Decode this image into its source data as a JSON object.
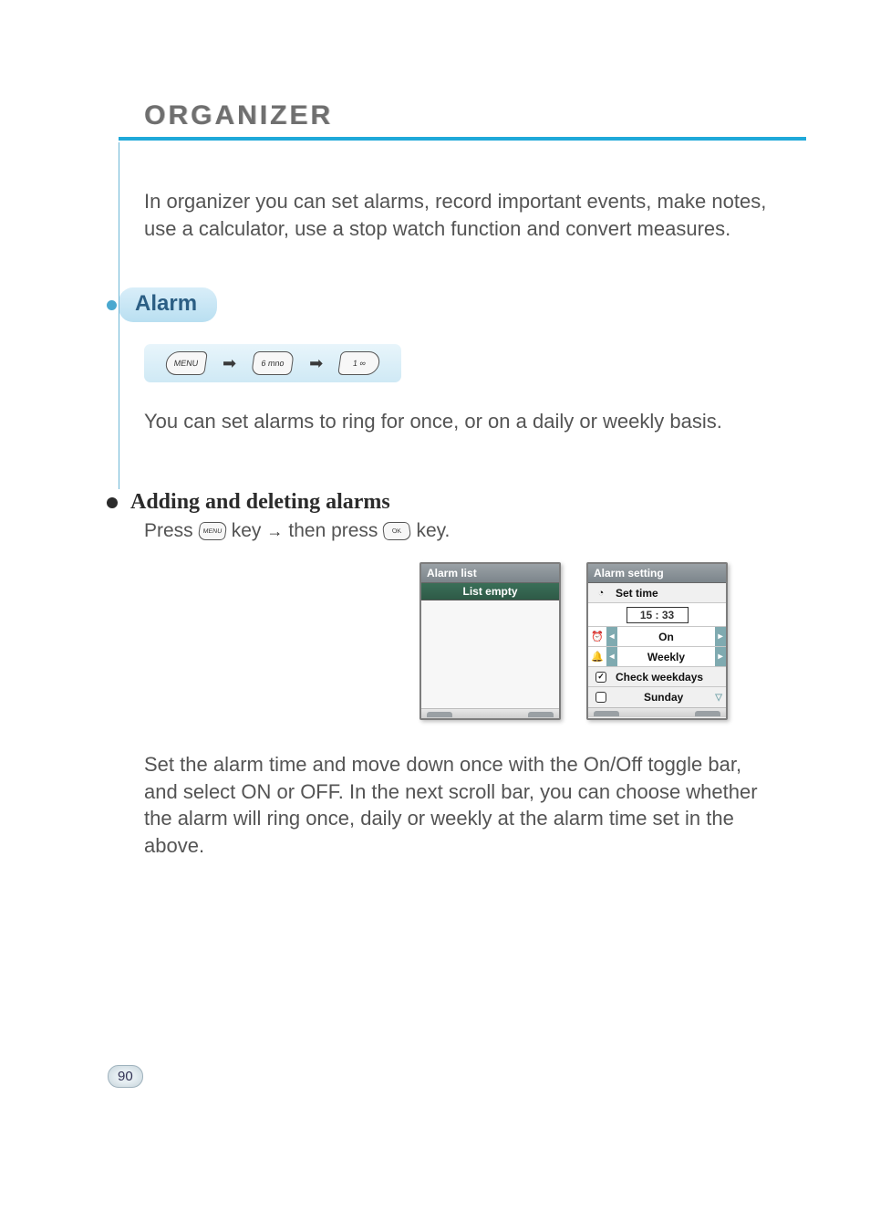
{
  "chapter_title": "ORGANIZER",
  "intro_text": "In organizer you can set alarms, record important events, make notes, use a calculator, use a stop watch function and convert measures.",
  "section_title": "Alarm",
  "key_path": {
    "k1": "MENU",
    "k2": "6 mno",
    "k3": "1 ∞"
  },
  "alarm_intro": "You can set alarms to ring for once, or on a daily or weekly basis.",
  "subhead": "Adding and deleting alarms",
  "press": {
    "p1": "Press",
    "key1": "MENU",
    "mid": "key",
    "then": "then press",
    "key2": "OK",
    "end": "key."
  },
  "screen_left": {
    "title": "Alarm list",
    "band": "List empty"
  },
  "screen_right": {
    "title": "Alarm setting",
    "set_time_label": "Set time",
    "time_value": "15 : 33",
    "onoff": "On",
    "repeat": "Weekly",
    "check_label": "Check weekdays",
    "day": "Sunday"
  },
  "explain": "Set the alarm time and move down once with the On/Off toggle bar, and select ON or OFF. In the next scroll bar, you can choose whether the alarm will ring once, daily or weekly at the alarm time set in the above.",
  "page_number": "90"
}
